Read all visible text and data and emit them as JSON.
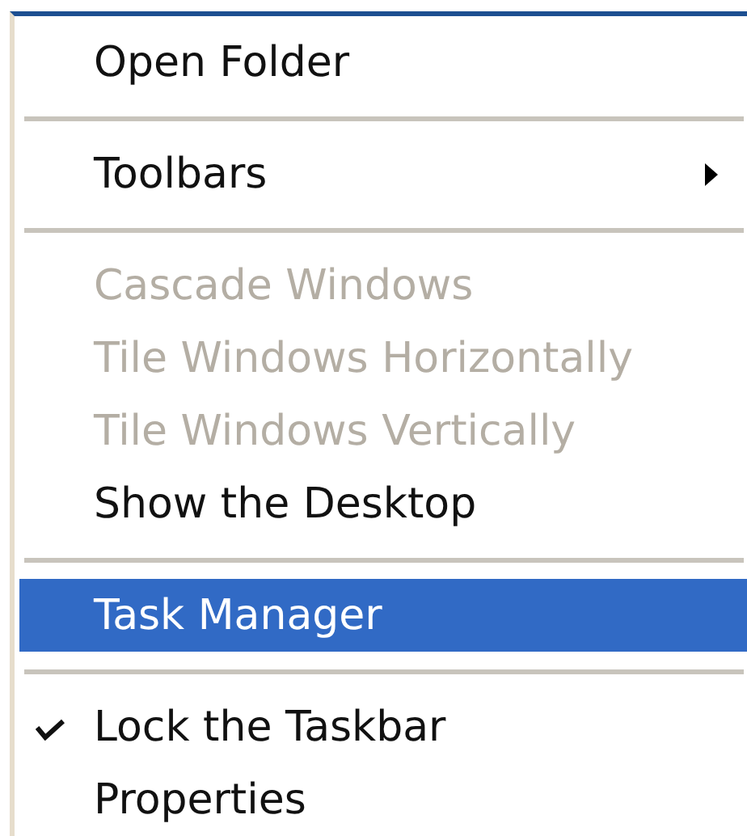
{
  "menu": {
    "items": [
      {
        "kind": "item",
        "label": "Open Folder",
        "disabled": false,
        "selected": false,
        "checked": false,
        "submenu": false
      },
      {
        "kind": "separator"
      },
      {
        "kind": "item",
        "label": "Toolbars",
        "disabled": false,
        "selected": false,
        "checked": false,
        "submenu": true
      },
      {
        "kind": "separator"
      },
      {
        "kind": "item",
        "label": "Cascade Windows",
        "disabled": true,
        "selected": false,
        "checked": false,
        "submenu": false
      },
      {
        "kind": "item",
        "label": "Tile Windows Horizontally",
        "disabled": true,
        "selected": false,
        "checked": false,
        "submenu": false
      },
      {
        "kind": "item",
        "label": "Tile Windows Vertically",
        "disabled": true,
        "selected": false,
        "checked": false,
        "submenu": false
      },
      {
        "kind": "item",
        "label": "Show the Desktop",
        "disabled": false,
        "selected": false,
        "checked": false,
        "submenu": false
      },
      {
        "kind": "separator"
      },
      {
        "kind": "item",
        "label": "Task Manager",
        "disabled": false,
        "selected": true,
        "checked": false,
        "submenu": false
      },
      {
        "kind": "separator"
      },
      {
        "kind": "item",
        "label": "Lock the Taskbar",
        "disabled": false,
        "selected": false,
        "checked": true,
        "submenu": false
      },
      {
        "kind": "item",
        "label": "Properties",
        "disabled": false,
        "selected": false,
        "checked": false,
        "submenu": false
      }
    ]
  }
}
